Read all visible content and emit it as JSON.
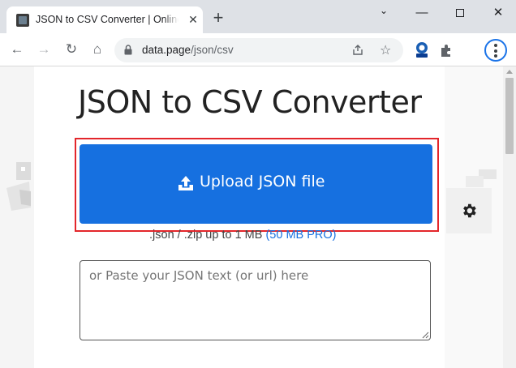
{
  "browser": {
    "tab_title": "JSON to CSV Converter | Online Tool",
    "tab_close": "✕",
    "new_tab": "+",
    "window": {
      "minimize": "—",
      "close": "✕",
      "chevron": "⌄"
    },
    "url_host": "data.page",
    "url_path": "/json/csv"
  },
  "icons": {
    "back": "←",
    "forward": "→",
    "reload": "↻",
    "home": "⌂",
    "star": "☆"
  },
  "page": {
    "title": "JSON to CSV Converter",
    "upload_label": "Upload JSON file",
    "limits_text": ".json / .zip up to 1 MB",
    "limits_pro": "(50 MB PRO)",
    "paste_placeholder": "or Paste your JSON text (or url) here"
  },
  "colors": {
    "accent": "#1670e0",
    "highlight": "#e3262b"
  }
}
